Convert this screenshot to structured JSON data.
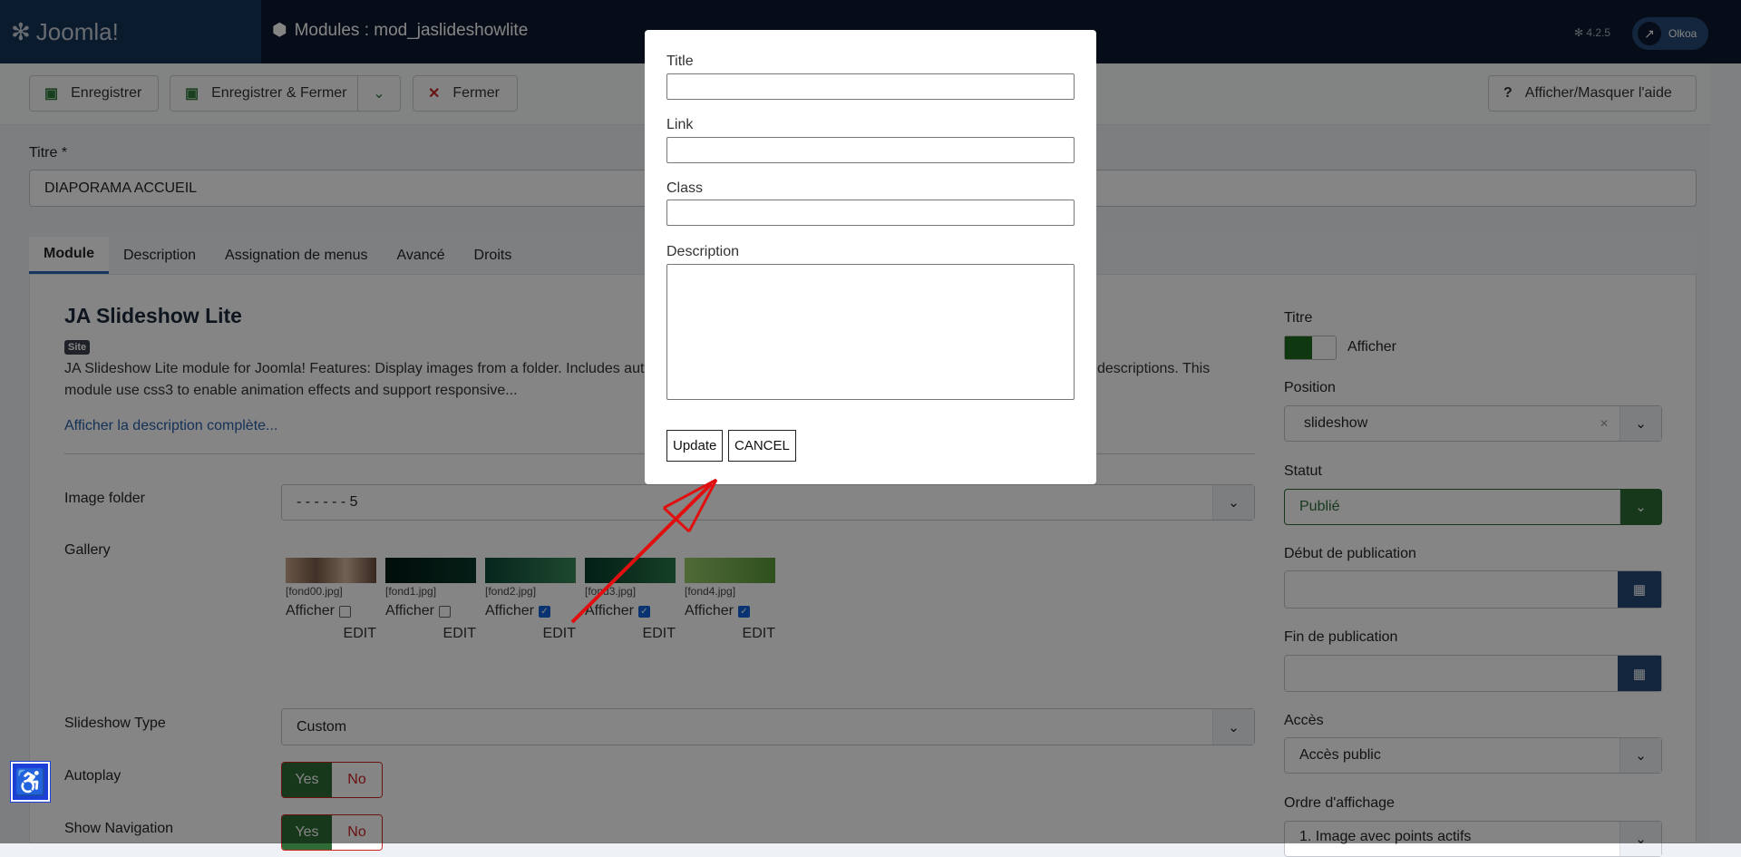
{
  "header": {
    "logo": "Joomla!",
    "title": "Modules : mod_jaslideshowlite",
    "version": "4.2.5",
    "user": "Olkoa"
  },
  "toolbar": {
    "save": "Enregistrer",
    "save_close": "Enregistrer & Fermer",
    "close": "Fermer",
    "help": "Afficher/Masquer l'aide"
  },
  "form": {
    "title_label": "Titre *",
    "title_value": "DIAPORAMA ACCUEIL"
  },
  "tabs": [
    "Module",
    "Description",
    "Assignation de menus",
    "Avancé",
    "Droits"
  ],
  "module": {
    "heading": "JA Slideshow Lite",
    "badge": "Site",
    "desc_line1_left": "JA Slideshow Lite module for Joomla! Features: Display images from a folder. Includes aut",
    "desc_line1_right": "descriptions. This",
    "desc_line2": "module use css3 to enable animation effects and support responsive...",
    "more_link": "Afficher la description complète..."
  },
  "fields": {
    "image_folder_label": "Image folder",
    "image_folder_value": "- - - - - - 5",
    "gallery_label": "Gallery",
    "slideshow_type_label": "Slideshow Type",
    "slideshow_type_value": "Custom",
    "autoplay_label": "Autoplay",
    "show_nav_label": "Show Navigation",
    "yes": "Yes",
    "no": "No"
  },
  "gallery": [
    {
      "file": "[fond00.jpg]",
      "show": "Afficher",
      "checked": false,
      "edit": "EDIT"
    },
    {
      "file": "[fond1.jpg]",
      "show": "Afficher",
      "checked": false,
      "edit": "EDIT"
    },
    {
      "file": "[fond2.jpg]",
      "show": "Afficher",
      "checked": true,
      "edit": "EDIT"
    },
    {
      "file": "[fond3.jpg]",
      "show": "Afficher",
      "checked": true,
      "edit": "EDIT"
    },
    {
      "file": "[fond4.jpg]",
      "show": "Afficher",
      "checked": true,
      "edit": "EDIT"
    }
  ],
  "sidebar": {
    "titre_label": "Titre",
    "titre_toggle": "Afficher",
    "position_label": "Position",
    "position_value": "slideshow",
    "statut_label": "Statut",
    "statut_value": "Publié",
    "debut_label": "Début de publication",
    "fin_label": "Fin de publication",
    "acces_label": "Accès",
    "acces_value": "Accès public",
    "ordre_label": "Ordre d'affichage",
    "ordre_value": "1. Image avec points actifs"
  },
  "modal": {
    "title_label": "Title",
    "link_label": "Link",
    "class_label": "Class",
    "description_label": "Description",
    "update": "Update",
    "cancel": "CANCEL"
  },
  "colors": {
    "accent": "#264a75",
    "success": "#2f6b36",
    "danger": "#c22222",
    "annotation": "#e01010"
  }
}
